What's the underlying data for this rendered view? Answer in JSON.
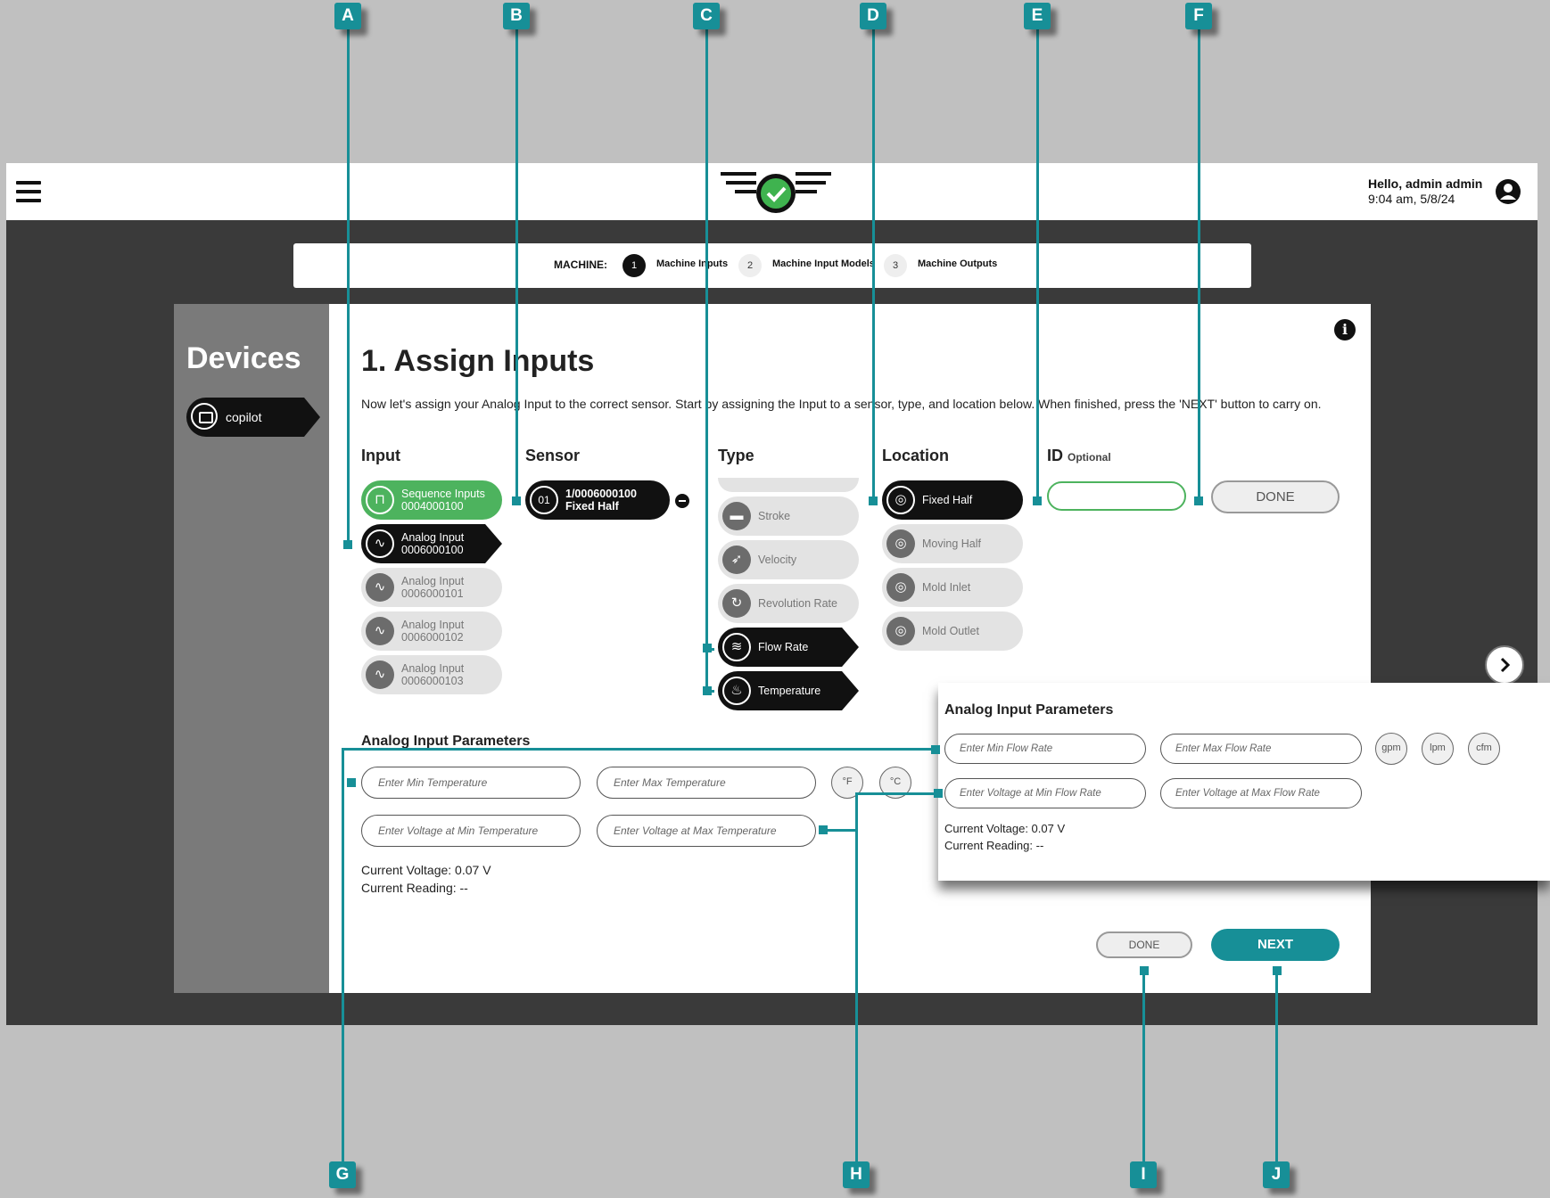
{
  "header": {
    "greeting": "Hello, admin admin",
    "datetime": "9:04 am, 5/8/24"
  },
  "stepper": {
    "label": "MACHINE:",
    "steps": [
      {
        "num": "1",
        "label": "Machine Inputs"
      },
      {
        "num": "2",
        "label": "Machine Input Models"
      },
      {
        "num": "3",
        "label": "Machine Outputs"
      }
    ]
  },
  "sidebar": {
    "title": "Devices",
    "device": "copilot"
  },
  "main": {
    "title": "1. Assign Inputs",
    "instructions": "Now let's assign your Analog Input to the correct sensor. Start by assigning the Input to a sensor, type, and location below. When finished, press the 'NEXT' button to carry on.",
    "columns": {
      "input": "Input",
      "sensor": "Sensor",
      "type": "Type",
      "location": "Location",
      "id": "ID",
      "id_optional": "Optional"
    },
    "inputs": [
      {
        "name": "Sequence Inputs",
        "code": "0004000100"
      },
      {
        "name": "Analog Input",
        "code": "0006000100"
      },
      {
        "name": "Analog Input",
        "code": "0006000101"
      },
      {
        "name": "Analog Input",
        "code": "0006000102"
      },
      {
        "name": "Analog Input",
        "code": "0006000103"
      }
    ],
    "sensor": {
      "num": "01",
      "line1": "1/0006000100",
      "line2": "Fixed Half"
    },
    "types": [
      "Stroke",
      "Velocity",
      "Revolution Rate",
      "Flow Rate",
      "Temperature"
    ],
    "locations": [
      "Fixed Half",
      "Moving Half",
      "Mold Inlet",
      "Mold Outlet"
    ],
    "id_done": "DONE",
    "params": {
      "title": "Analog Input Parameters",
      "min_temp_placeholder": "Enter Min Temperature",
      "max_temp_placeholder": "Enter Max Temperature",
      "volt_min_temp_placeholder": "Enter Voltage at Min Temperature",
      "volt_max_temp_placeholder": "Enter Voltage at Max Temperature",
      "unit_f": "°F",
      "unit_c": "°C",
      "current_voltage": "Current Voltage: 0.07 V",
      "current_reading": "Current Reading: --"
    },
    "done": "DONE",
    "next": "NEXT"
  },
  "overlay": {
    "title": "Analog Input Parameters",
    "min_flow_placeholder": "Enter Min Flow Rate",
    "max_flow_placeholder": "Enter Max Flow Rate",
    "volt_min_flow_placeholder": "Enter Voltage at Min Flow Rate",
    "volt_max_flow_placeholder": "Enter Voltage at Max Flow Rate",
    "units": [
      "gpm",
      "lpm",
      "cfm"
    ],
    "current_voltage": "Current Voltage: 0.07 V",
    "current_reading": "Current Reading: --"
  },
  "callouts": [
    "A",
    "B",
    "C",
    "D",
    "E",
    "F",
    "G",
    "H",
    "I",
    "J"
  ],
  "colors": {
    "accent": "#178f97",
    "green": "#4db35e",
    "dark": "#3a3a3a"
  }
}
